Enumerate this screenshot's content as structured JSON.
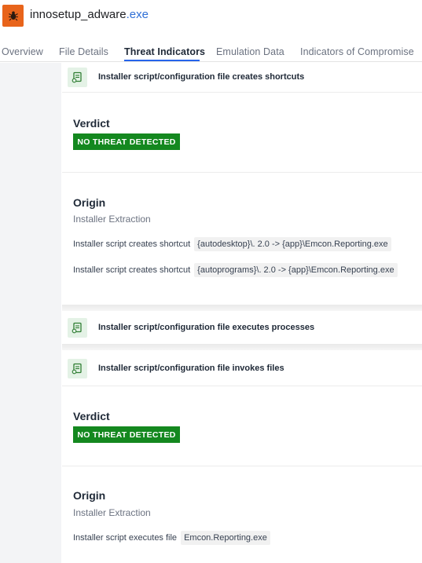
{
  "header": {
    "app_icon": "bug-icon",
    "brand_color": "#e8641b",
    "title_name": "innosetup_adware",
    "title_ext": ".exe"
  },
  "tabs": [
    {
      "label": "Overview",
      "active": false
    },
    {
      "label": "File Details",
      "active": false
    },
    {
      "label": "Threat Indicators",
      "active": true
    },
    {
      "label": "Emulation Data",
      "active": false
    },
    {
      "label": "Indicators of Compromise",
      "active": false
    }
  ],
  "indicators": [
    {
      "icon": "script-icon",
      "title": "Installer script/configuration file creates shortcuts",
      "expanded": true,
      "verdict_label": "Verdict",
      "verdict": "NO THREAT DETECTED",
      "origin_label": "Origin",
      "origin": "Installer Extraction",
      "details": [
        {
          "text": "Installer script creates shortcut",
          "code": "{autodesktop}\\. 2.0 -> {app}\\Emcon.Reporting.exe"
        },
        {
          "text": "Installer script creates shortcut",
          "code": "{autoprograms}\\. 2.0 -> {app}\\Emcon.Reporting.exe"
        }
      ]
    },
    {
      "icon": "script-icon",
      "title": "Installer script/configuration file executes processes",
      "expanded": false
    },
    {
      "icon": "script-icon",
      "title": "Installer script/configuration file invokes files",
      "expanded": true,
      "verdict_label": "Verdict",
      "verdict": "NO THREAT DETECTED",
      "origin_label": "Origin",
      "origin": "Installer Extraction",
      "details": [
        {
          "text": "Installer script executes file",
          "code": "Emcon.Reporting.exe"
        }
      ]
    }
  ],
  "colors": {
    "accent": "#2563eb",
    "verdict_badge": "#14881f",
    "indicator_icon_bg": "#e4f2e6"
  }
}
